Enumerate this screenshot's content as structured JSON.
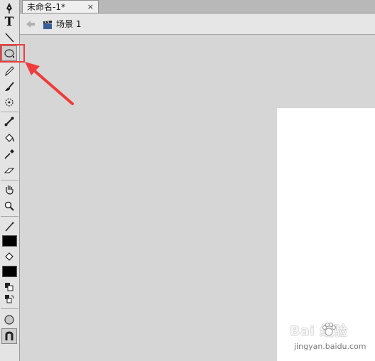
{
  "document_tab": {
    "title": "未命名-1*",
    "close_glyph": "×"
  },
  "scene": {
    "label": "场景 1"
  },
  "toolbar": {
    "tools": [
      {
        "name": "pen-icon"
      },
      {
        "name": "text-icon",
        "glyph": "T"
      },
      {
        "name": "line-icon"
      },
      {
        "name": "oval-icon",
        "selected": true
      },
      {
        "name": "pencil-icon"
      },
      {
        "name": "brush-icon"
      },
      {
        "name": "deco-icon"
      },
      {
        "name": "bone-icon"
      },
      {
        "name": "paint-bucket-icon"
      },
      {
        "name": "eyedropper-icon"
      },
      {
        "name": "eraser-icon"
      },
      {
        "name": "hand-icon"
      },
      {
        "name": "zoom-icon"
      },
      {
        "name": "stroke-color-icon"
      },
      {
        "name": "fill-color-icon"
      },
      {
        "name": "default-colors-icon"
      },
      {
        "name": "swap-colors-icon"
      },
      {
        "name": "object-drawing-icon"
      },
      {
        "name": "snap-magnet-icon"
      }
    ],
    "stroke_color": "#000000",
    "fill_color": "#000000"
  },
  "annotation": {
    "highlight_color": "#ef3b3b"
  },
  "watermark": {
    "brand": "Bai  经验",
    "url": "jingyan.baidu.com"
  }
}
